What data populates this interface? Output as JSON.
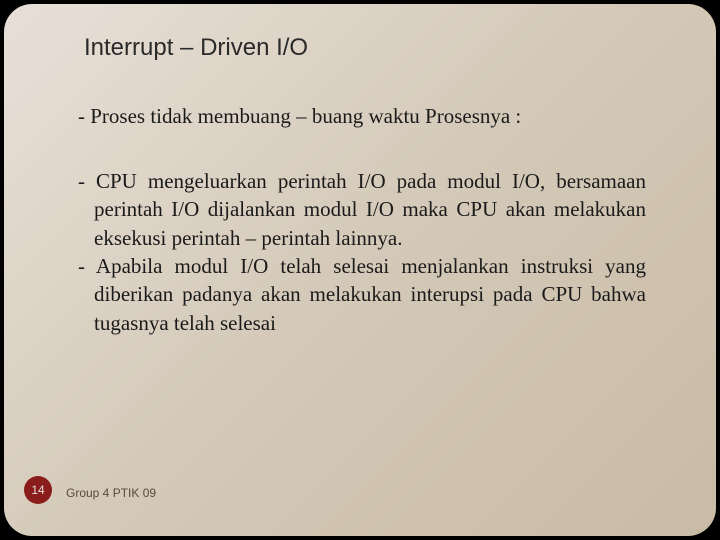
{
  "title": "Interrupt – Driven I/O",
  "bullets": {
    "b1": "- Proses tidak membuang – buang waktu Prosesnya :",
    "b2": "- CPU mengeluarkan perintah I/O pada modul I/O, bersamaan perintah I/O dijalankan modul I/O maka CPU akan melakukan eksekusi perintah – perintah lainnya.",
    "b3": "- Apabila modul I/O telah selesai menjalankan instruksi yang diberikan padanya akan melakukan interupsi pada CPU bahwa tugasnya telah selesai"
  },
  "page_number": "14",
  "footer": "Group 4  PTIK  09"
}
